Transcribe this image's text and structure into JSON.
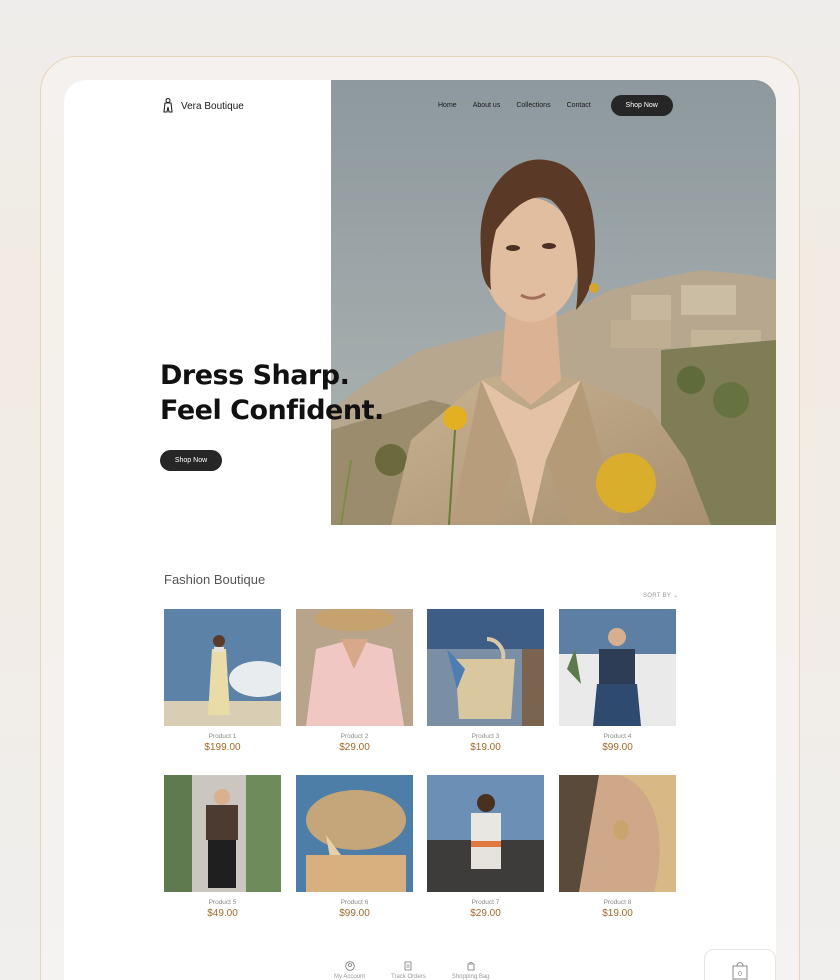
{
  "brand": {
    "name": "Vera Boutique",
    "logo_icon": "figure-logo-icon"
  },
  "nav": {
    "links": [
      "Home",
      "About us",
      "Collections",
      "Contact"
    ],
    "cta": "Shop Now"
  },
  "hero": {
    "headline_line1": "Dress Sharp.",
    "headline_line2": "Feel Confident.",
    "cta": "Shop Now"
  },
  "section": {
    "title": "Fashion Boutique",
    "sort_label": "SORT BY"
  },
  "products": [
    {
      "name": "Product 1",
      "price": "$199.00"
    },
    {
      "name": "Product 2",
      "price": "$29.00"
    },
    {
      "name": "Product 3",
      "price": "$19.00"
    },
    {
      "name": "Product 4",
      "price": "$99.00"
    },
    {
      "name": "Product 5",
      "price": "$49.00"
    },
    {
      "name": "Product 6",
      "price": "$99.00"
    },
    {
      "name": "Product 7",
      "price": "$29.00"
    },
    {
      "name": "Product 8",
      "price": "$19.00"
    }
  ],
  "bottom_nav": [
    {
      "label": "My Account",
      "icon": "user-icon"
    },
    {
      "label": "Track Orders",
      "icon": "document-icon"
    },
    {
      "label": "Shopping Bag",
      "icon": "bag-icon"
    }
  ],
  "cart": {
    "count": "0",
    "icon": "shopping-bag-icon"
  },
  "colors": {
    "button_dark": "#262626",
    "price": "#a06a2a",
    "frame_border": "#e6d6b8"
  }
}
